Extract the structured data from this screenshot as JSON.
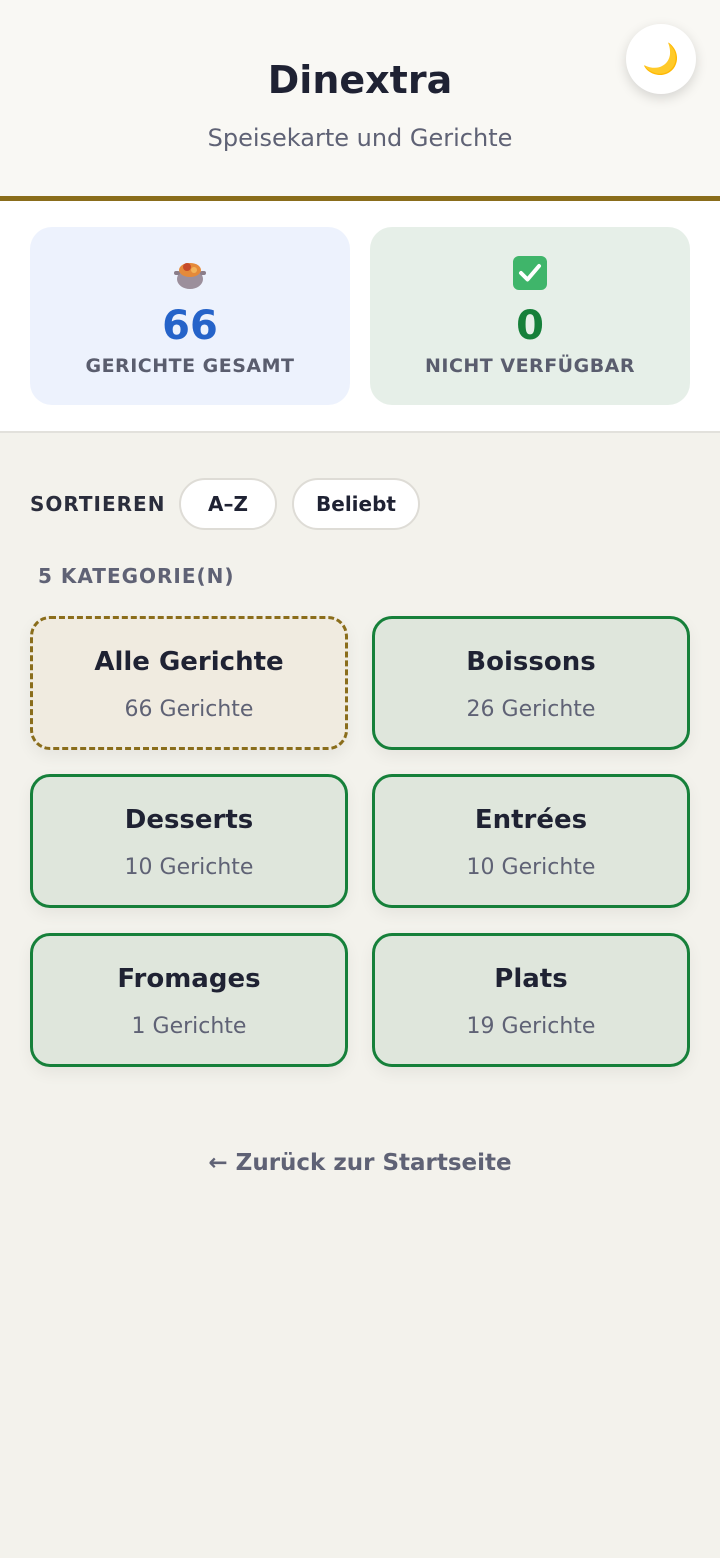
{
  "header": {
    "title": "Dinextra",
    "subtitle": "Speisekarte und Gerichte",
    "theme_toggle_icon": "moon-icon"
  },
  "stats": {
    "total": {
      "icon": "cooking-pot-icon",
      "value": "66",
      "label": "GERICHTE GESAMT"
    },
    "unavailable": {
      "icon": "check-box-icon",
      "value": "0",
      "label": "NICHT VERFÜGBAR"
    }
  },
  "sort": {
    "label": "SORTIEREN",
    "options": [
      "A–Z",
      "Beliebt"
    ]
  },
  "categories_count": "5 KATEGORIE(N)",
  "categories": [
    {
      "name": "Alle Gerichte",
      "count": "66 Gerichte",
      "active": true
    },
    {
      "name": "Boissons",
      "count": "26 Gerichte",
      "active": false
    },
    {
      "name": "Desserts",
      "count": "10 Gerichte",
      "active": false
    },
    {
      "name": "Entrées",
      "count": "10 Gerichte",
      "active": false
    },
    {
      "name": "Fromages",
      "count": "1 Gerichte",
      "active": false
    },
    {
      "name": "Plats",
      "count": "19 Gerichte",
      "active": false
    }
  ],
  "back_link": "← Zurück zur Startseite",
  "colors": {
    "accent_gold": "#8a6d1b",
    "total_blue": "#2563c9",
    "available_green": "#16803a"
  }
}
